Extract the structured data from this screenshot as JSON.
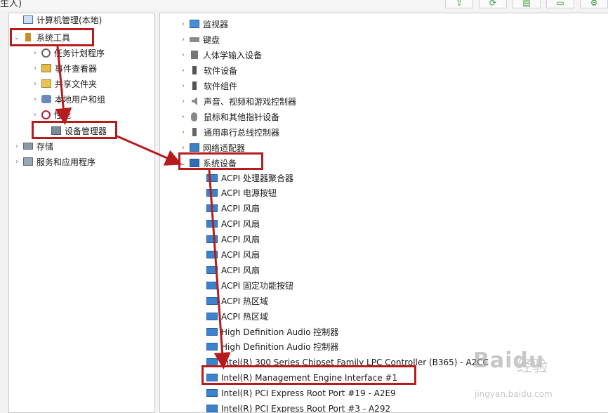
{
  "top_text": "生人)",
  "toolbar_buttons": [
    {
      "icon": "export-icon",
      "glyph": "⇪"
    },
    {
      "icon": "refresh-icon",
      "glyph": "⟳"
    },
    {
      "icon": "properties-icon",
      "glyph": "▤"
    },
    {
      "icon": "help-icon",
      "glyph": "▭"
    },
    {
      "icon": "settings-icon",
      "glyph": "⚙"
    }
  ],
  "left_tree": [
    {
      "label": "计算机管理(本地)",
      "icon": "computer-icon",
      "cls": "i-computer",
      "chev": ""
    },
    {
      "label": "系统工具",
      "icon": "tools-icon",
      "cls": "i-tools",
      "chev": "⌄"
    },
    {
      "label": "任务计划程序",
      "icon": "clock-icon",
      "cls": "i-clock",
      "chev": "›"
    },
    {
      "label": "事件查看器",
      "icon": "event-log-icon",
      "cls": "i-log",
      "chev": "›"
    },
    {
      "label": "共享文件夹",
      "icon": "shared-folder-icon",
      "cls": "i-folder",
      "chev": "›"
    },
    {
      "label": "本地用户和组",
      "icon": "users-icon",
      "cls": "i-users",
      "chev": "›"
    },
    {
      "label": "性能",
      "icon": "performance-icon",
      "cls": "i-perf",
      "chev": "›"
    },
    {
      "label": "设备管理器",
      "icon": "device-manager-icon",
      "cls": "i-devmgr",
      "chev": ""
    },
    {
      "label": "存储",
      "icon": "storage-icon",
      "cls": "i-storage",
      "chev": "›"
    },
    {
      "label": "服务和应用程序",
      "icon": "services-icon",
      "cls": "i-services",
      "chev": "›"
    }
  ],
  "device_categories": [
    {
      "label": "监视器",
      "icon": "monitor-icon",
      "cls": "i-monitor"
    },
    {
      "label": "键盘",
      "icon": "keyboard-icon",
      "cls": "i-keyboard"
    },
    {
      "label": "人体学输入设备",
      "icon": "hid-icon",
      "cls": "i-hid"
    },
    {
      "label": "软件设备",
      "icon": "software-device-icon",
      "cls": "i-chip"
    },
    {
      "label": "软件组件",
      "icon": "software-component-icon",
      "cls": "i-chip"
    },
    {
      "label": "声音、视频和游戏控制器",
      "icon": "speaker-icon",
      "cls": "i-speaker"
    },
    {
      "label": "鼠标和其他指针设备",
      "icon": "mouse-icon",
      "cls": "i-mouse"
    },
    {
      "label": "通用串行总线控制器",
      "icon": "usb-icon",
      "cls": "i-usb"
    },
    {
      "label": "网络适配器",
      "icon": "network-adapter-icon",
      "cls": "i-network"
    },
    {
      "label": "系统设备",
      "icon": "system-devices-icon",
      "cls": "i-sysfolder",
      "expanded": true
    }
  ],
  "system_devices": [
    "ACPI 处理器聚合器",
    "ACPI 电源按钮",
    "ACPI 风扇",
    "ACPI 风扇",
    "ACPI 风扇",
    "ACPI 风扇",
    "ACPI 风扇",
    "ACPI 固定功能按钮",
    "ACPI 热区域",
    "ACPI 热区域",
    "High Definition Audio 控制器",
    "High Definition Audio 控制器",
    "Intel(R) 300 Series Chipset Family LPC Controller (B365) - A2CC",
    "Intel(R) Management Engine Interface #1",
    "Intel(R) PCI Express Root Port #19 - A2E9",
    "Intel(R) PCI Express Root Port #3 - A292"
  ],
  "highlight_color": "#b71c1c",
  "watermark": {
    "logo": "Baidu",
    "sub": "经验",
    "url": "jingyan.baidu.com"
  }
}
